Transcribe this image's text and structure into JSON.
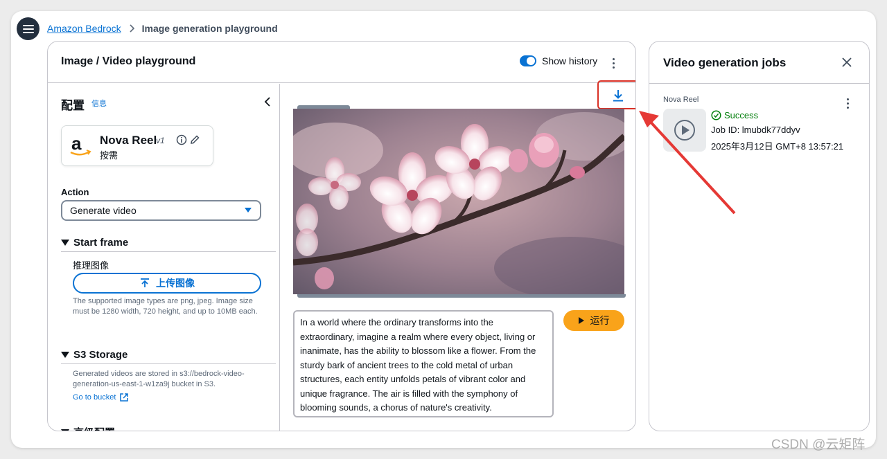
{
  "nav": {
    "menu_icon": "hamburger-menu-icon",
    "breadcrumb_root": "Amazon Bedrock",
    "breadcrumb_current": "Image generation playground"
  },
  "playground": {
    "title": "Image / Video playground",
    "show_history_label": "Show history",
    "show_history_on": true
  },
  "config": {
    "title": "配置",
    "info_link": "信息",
    "model": {
      "name": "Nova Reel",
      "version": "v1",
      "mode": "按需"
    },
    "action_label": "Action",
    "action_value": "Generate video",
    "start_frame": {
      "heading": "Start frame",
      "field_label": "推理图像",
      "upload_label": "上传图像",
      "help": "The supported image types are png, jpeg. Image size must be 1280 width, 720 height, and up to 10MB each."
    },
    "s3": {
      "heading": "S3 Storage",
      "help": "Generated videos are stored in s3://bedrock-video-generation-us-east-1-w1za9j bucket in S3.",
      "link": "Go to bucket"
    },
    "advanced_heading": "高级配置"
  },
  "output": {
    "prompt": "In a world where the ordinary transforms into the extraordinary, imagine a realm where every object, living or inanimate, has the ability to blossom like a flower. From the sturdy bark of ancient trees to the cold metal of urban structures, each entity unfolds petals of vibrant color and unique fragrance. The air is filled with the symphony of blooming sounds, a chorus of nature's creativity.",
    "run_label": "运行"
  },
  "jobs": {
    "title": "Video generation jobs",
    "items": [
      {
        "model": "Nova Reel",
        "status": "Success",
        "job_id": "Job ID: lmubdk77ddyv",
        "time": "2025年3月12日 GMT+8 13:57:21"
      }
    ]
  },
  "colors": {
    "accent": "#0972d3",
    "run_button": "#f9a31a",
    "success": "#037f0c",
    "annotation": "#d93025"
  },
  "watermark": "CSDN @云矩阵"
}
